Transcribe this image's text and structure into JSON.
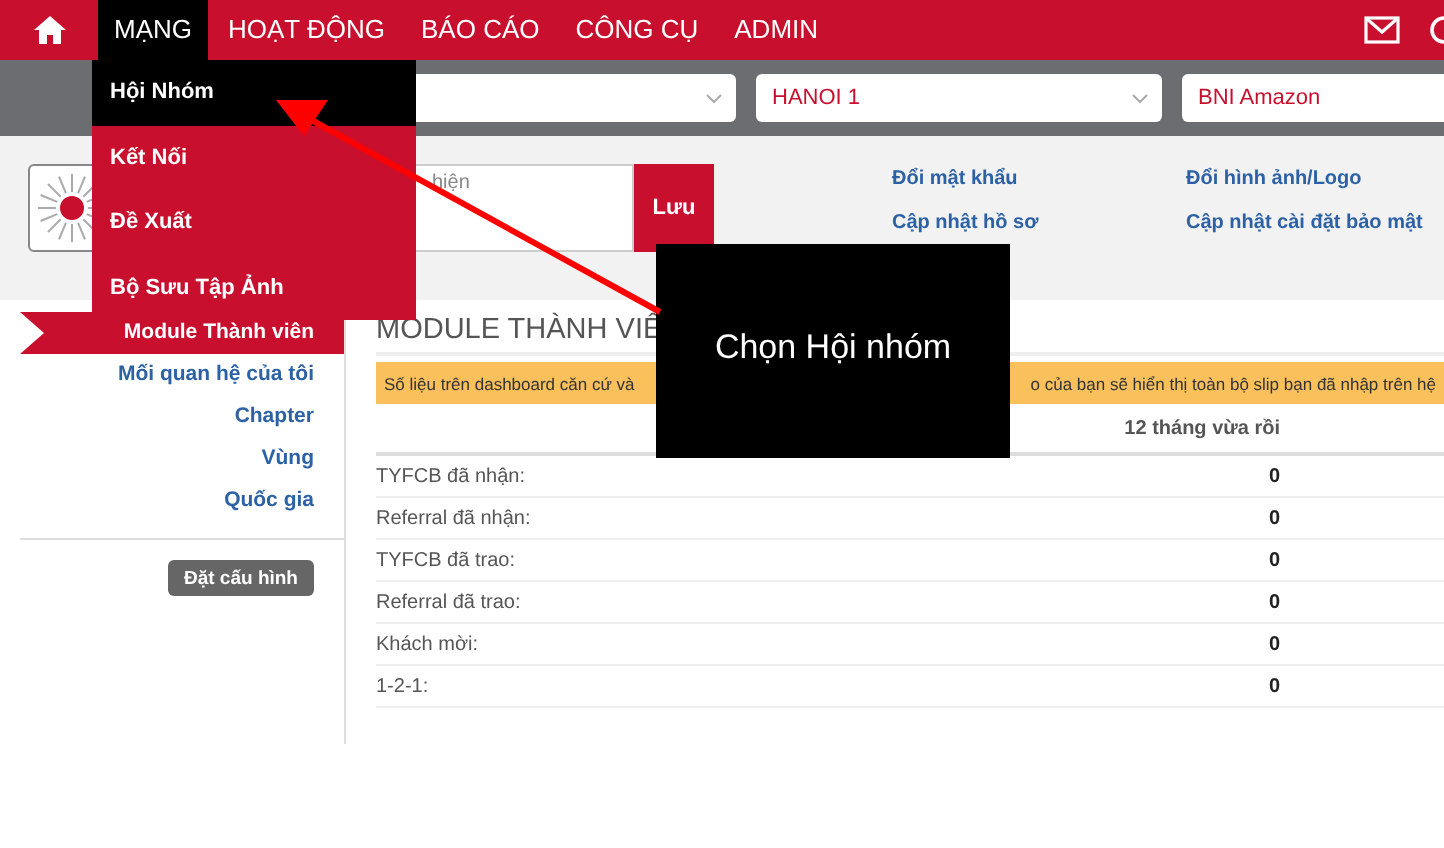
{
  "nav": {
    "items": [
      {
        "label": "MẠNG",
        "selected": true
      },
      {
        "label": "HOẠT ĐỘNG",
        "selected": false
      },
      {
        "label": "BÁO CÁO",
        "selected": false
      },
      {
        "label": "CÔNG CỤ",
        "selected": false
      },
      {
        "label": "ADMIN",
        "selected": false
      }
    ]
  },
  "selectors": [
    {
      "kind": "empty"
    },
    {
      "kind": "value",
      "value": "HANOI 1"
    },
    {
      "kind": "value",
      "value": "BNI Amazon"
    }
  ],
  "dropdown": {
    "items": [
      {
        "label": "Hội Nhóm",
        "selected": true
      },
      {
        "label": "Kết Nối",
        "selected": false
      },
      {
        "label": "Đề Xuất",
        "selected": false
      },
      {
        "label": "Bộ Sưu Tập Ảnh",
        "selected": false
      }
    ]
  },
  "profile": {
    "placeholder": "hiện",
    "save_button": "Lưu",
    "links": [
      "Đổi mật khẩu",
      "Cập nhật hồ sơ",
      "Đổi hình ảnh/Logo",
      "Cập nhật cài đặt bảo mật"
    ]
  },
  "sidebar": {
    "items": [
      {
        "label": "Module Thành viên",
        "selected": true
      },
      {
        "label": "Mối quan hệ của tôi",
        "selected": false
      },
      {
        "label": "Chapter",
        "selected": false
      },
      {
        "label": "Vùng",
        "selected": false
      },
      {
        "label": "Quốc gia",
        "selected": false
      }
    ],
    "button": "Đặt cấu hình"
  },
  "main": {
    "title": "MODULE THÀNH VIÊ",
    "warning": {
      "text_start": "Số liệu trên dashboard căn cứ và",
      "text_end": "o của bạn sẽ hiển thị toàn bộ slip bạn đã nhập trên hệ"
    },
    "table": {
      "columns": [
        "12 tháng vừa rồi"
      ],
      "rows": [
        {
          "label": "TYFCB đã nhận:",
          "value": "0"
        },
        {
          "label": "Referral đã nhận:",
          "value": "0"
        },
        {
          "label": "TYFCB đã trao:",
          "value": "0"
        },
        {
          "label": "Referral đã trao:",
          "value": "0"
        },
        {
          "label": "Khách mời:",
          "value": "0"
        },
        {
          "label": "1-2-1:",
          "value": "0"
        }
      ]
    }
  },
  "annotation": {
    "text": "Chọn Hội nhóm"
  }
}
